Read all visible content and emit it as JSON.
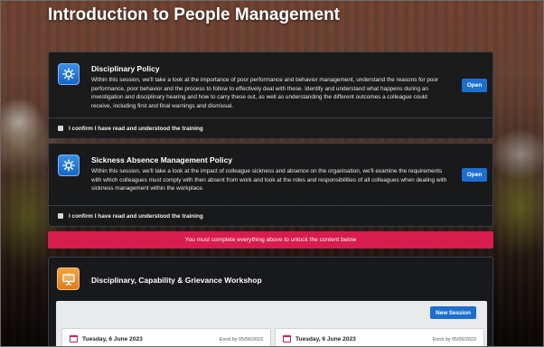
{
  "page": {
    "title": "Introduction to People Management"
  },
  "cards": [
    {
      "title": "Disciplinary Policy",
      "description": "Within this session, we'll take a look at the importance of poor performance and behavior management, understand the reasons for poor performance, poor behavior and the process to follow to effectively deal with these. Identify and understand what happens during an investigation and disciplinary hearing and how to carry these out, as well as understanding the different outcomes a colleague could receive, including first and final warnings and dismissal.",
      "open_label": "Open",
      "confirm_label": "I confirm I have read and understood the training",
      "icon": "gear-in-square-icon"
    },
    {
      "title": "Sickness Absence Management Policy",
      "description": "Within this session, we'll take a look at the impact of colleague sickness and absence on the organisation, we'll examine the requirements with which colleagues must comply with then absent from work and look at the roles and responsibilities of all colleagues when dealing with sickness management within the workplace.",
      "open_label": "Open",
      "confirm_label": "I confirm I have read and understood the training",
      "icon": "gear-in-square-icon"
    }
  ],
  "warning": {
    "text": "You must complete everything above to unlock the content below"
  },
  "workshop": {
    "title": "Disciplinary, Capability & Grievance Workshop",
    "icon": "presentation-icon",
    "new_session_label": "New Session",
    "sessions": [
      {
        "date": "Tuesday, 6 June 2023",
        "enrol_by": "Enrol by 05/06/2023"
      },
      {
        "date": "Tuesday, 6 June 2023",
        "enrol_by": "Enrol by 05/06/2023"
      }
    ]
  },
  "colors": {
    "accent_blue": "#1a6fd1",
    "warning_red": "#d81c4d",
    "card_bg": "#16181b",
    "icon_orange": "#e07a10"
  }
}
